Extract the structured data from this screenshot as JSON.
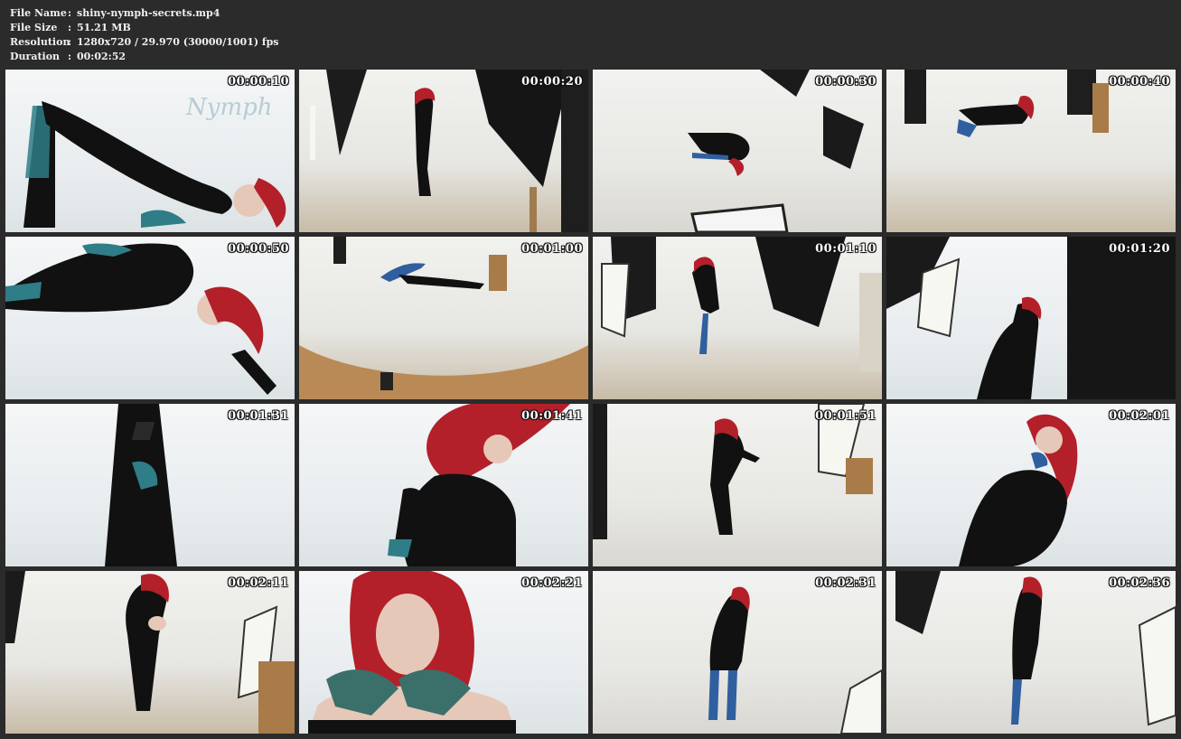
{
  "file_info": {
    "file_name_label": "File Name",
    "file_name": "shiny-nymph-secrets.mp4",
    "file_size_label": "File Size",
    "file_size": "51.21 MB",
    "resolution_label": "Resolution",
    "resolution": "1280x720 / 29.970 (30000/1001) fps",
    "duration_label": "Duration",
    "duration": "00:02:52",
    "separator": ":"
  },
  "thumbnails": [
    {
      "timestamp": "00:00:10"
    },
    {
      "timestamp": "00:00:20"
    },
    {
      "timestamp": "00:00:30"
    },
    {
      "timestamp": "00:00:40"
    },
    {
      "timestamp": "00:00:50"
    },
    {
      "timestamp": "00:01:00"
    },
    {
      "timestamp": "00:01:10"
    },
    {
      "timestamp": "00:01:20"
    },
    {
      "timestamp": "00:01:31"
    },
    {
      "timestamp": "00:01:41"
    },
    {
      "timestamp": "00:01:51"
    },
    {
      "timestamp": "00:02:01"
    },
    {
      "timestamp": "00:02:11"
    },
    {
      "timestamp": "00:02:21"
    },
    {
      "timestamp": "00:02:31"
    },
    {
      "timestamp": "00:02:36"
    }
  ],
  "colors": {
    "background": "#2b2b2b",
    "text": "#f0f0f0",
    "latex": "#111111",
    "hair": "#b3202a",
    "teal": "#2f7d86",
    "studio": "#ebebe7"
  }
}
